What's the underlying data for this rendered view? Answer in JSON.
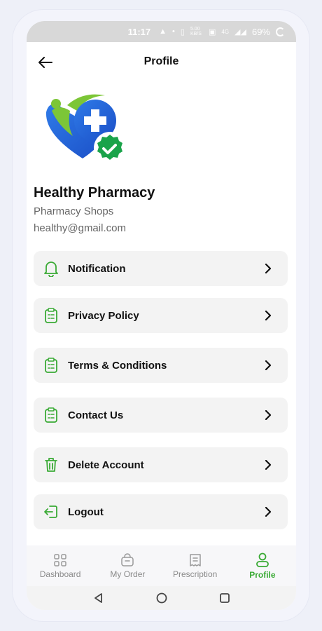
{
  "status_bar": {
    "time": "11:17",
    "speed": "5.00 KB/S",
    "network": "4G",
    "battery": "69%"
  },
  "header": {
    "title": "Profile",
    "back_icon": "arrow-left-icon"
  },
  "profile": {
    "name": "Healthy Pharmacy",
    "type": "Pharmacy Shops",
    "email": "healthy@gmail.com"
  },
  "menu": {
    "items": [
      {
        "label": "Notification",
        "icon": "bell-icon"
      },
      {
        "label": "Privacy Policy",
        "icon": "clipboard-icon"
      },
      {
        "label": "Terms & Conditions",
        "icon": "clipboard-icon"
      },
      {
        "label": "Contact Us",
        "icon": "clipboard-icon"
      },
      {
        "label": "Delete Account",
        "icon": "trash-icon"
      },
      {
        "label": "Logout",
        "icon": "logout-icon"
      }
    ]
  },
  "bottom_nav": {
    "items": [
      {
        "label": "Dashboard",
        "icon": "grid-icon",
        "active": false
      },
      {
        "label": "My Order",
        "icon": "bag-icon",
        "active": false
      },
      {
        "label": "Prescription",
        "icon": "receipt-icon",
        "active": false
      },
      {
        "label": "Profile",
        "icon": "user-icon",
        "active": true
      }
    ]
  },
  "colors": {
    "accent": "#3aaa35",
    "card_bg": "#f3f3f3",
    "status_bar": "#d8d8d8"
  }
}
